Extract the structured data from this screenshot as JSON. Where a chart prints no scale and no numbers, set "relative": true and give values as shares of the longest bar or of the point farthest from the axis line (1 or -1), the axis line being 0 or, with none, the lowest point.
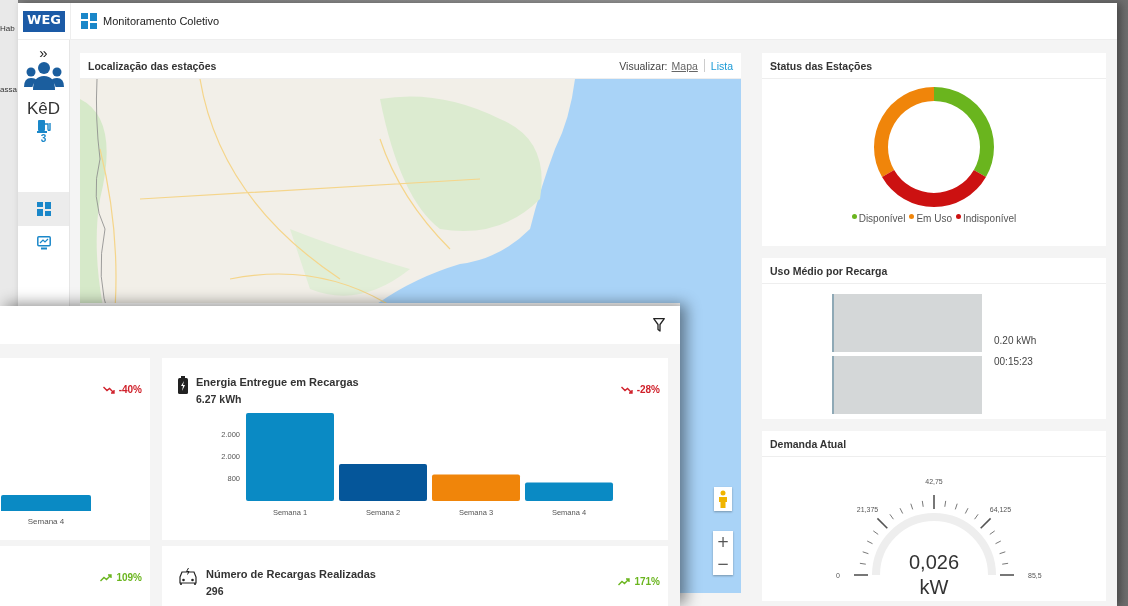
{
  "background_window": {
    "texts": [
      "Hab",
      "assa"
    ]
  },
  "main_window": {
    "logo": "WEG",
    "title": "Monitoramento Coletivo"
  },
  "sidebar": {
    "expand": "»",
    "group_name": "KêD",
    "station_count": "3",
    "nav": [
      {
        "kind": "dashboard",
        "selected": true
      },
      {
        "kind": "monitor",
        "selected": false
      }
    ]
  },
  "map_card": {
    "title": "Localização das estações",
    "view_label": "Visualizar:",
    "views": [
      {
        "label": "Mapa",
        "selected": true
      },
      {
        "label": "Lista",
        "selected": false
      }
    ],
    "zoom_in": "+",
    "zoom_out": "−"
  },
  "status_card": {
    "title": "Status das Estações",
    "legend": [
      {
        "label": "Disponível",
        "color": "#6ab51e"
      },
      {
        "label": "Em Uso",
        "color": "#f0850a"
      },
      {
        "label": "Indisponível",
        "color": "#cc1111"
      }
    ]
  },
  "usage_card": {
    "title": "Uso Médio por Recarga",
    "rows": [
      "0.20 kWh",
      "00:15:23"
    ]
  },
  "demand_card": {
    "title": "Demanda Atual",
    "scale": [
      "0",
      "21,375",
      "42,75",
      "64,125",
      "85,5"
    ],
    "value": "0,026",
    "unit": "kW"
  },
  "front_window": {
    "rows": [
      {
        "cards": [
          {
            "kind": "partial",
            "trend": "-40%",
            "rising": false,
            "bar_label": "Semana 4"
          },
          {
            "kind": "chart",
            "title": "Energia Entregue em Recargas",
            "value": "6.27 kWh",
            "trend": "-28%",
            "rising": false,
            "ytick_labels": [
              "2.000",
              "2.000",
              "800"
            ],
            "chart_data": {
              "type": "bar",
              "relative": true,
              "categories": [
                "Semana 1",
                "Semana 2",
                "Semana 3",
                "Semana 4"
              ],
              "values": [
                1,
                0.42,
                0.3,
                0.21
              ],
              "colors": [
                "#0a8ac4",
                "#05569a",
                "#f0850a",
                "#0a8ac4"
              ]
            }
          }
        ]
      },
      {
        "cards": [
          {
            "kind": "partial",
            "trend": "109%",
            "rising": true
          },
          {
            "kind": "cut",
            "title": "Número de Recargas Realizadas",
            "value": "296",
            "trend": "171%",
            "rising": true
          }
        ]
      }
    ]
  }
}
